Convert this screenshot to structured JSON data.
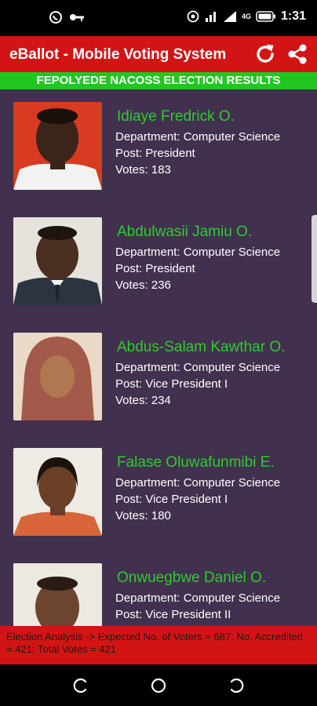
{
  "status_bar": {
    "time": "1:31",
    "network": "4G",
    "icons": [
      "whatsapp-icon",
      "key-icon",
      "hotspot-icon",
      "wifi-icon",
      "signal-icon",
      "battery-icon"
    ]
  },
  "app_bar": {
    "title": "eBallot - Mobile Voting System",
    "icons": [
      "refresh-icon",
      "share-icon"
    ]
  },
  "banner": "FEPOLYEDE NACOSS ELECTION RESULTS",
  "candidates": [
    {
      "name": "Idiaye Fredrick O.",
      "department": "Department: Computer Science",
      "post": "Post:  President",
      "votes": "Votes:  183"
    },
    {
      "name": "Abdulwasii Jamiu O.",
      "department": "Department: Computer Science",
      "post": "Post:  President",
      "votes": "Votes:  236"
    },
    {
      "name": "Abdus-Salam Kawthar O.",
      "department": "Department: Computer Science",
      "post": "Post:  Vice President I",
      "votes": "Votes:  234"
    },
    {
      "name": "Falase Oluwafunmibi E.",
      "department": "Department: Computer Science",
      "post": "Post:  Vice President I",
      "votes": "Votes:  180"
    },
    {
      "name": "Onwuegbwe Daniel O.",
      "department": "Department: Computer Science",
      "post": "Post:  Vice President II",
      "votes": ""
    }
  ],
  "footer": "Election Analysis -> Expected No. of Voters = 687; No. Accredited = 421; Total Votes = 421",
  "colors": {
    "app_bar": "#d31414",
    "banner": "#21c721",
    "list_bg": "#41314e",
    "candidate_name": "#2ecb2e"
  }
}
